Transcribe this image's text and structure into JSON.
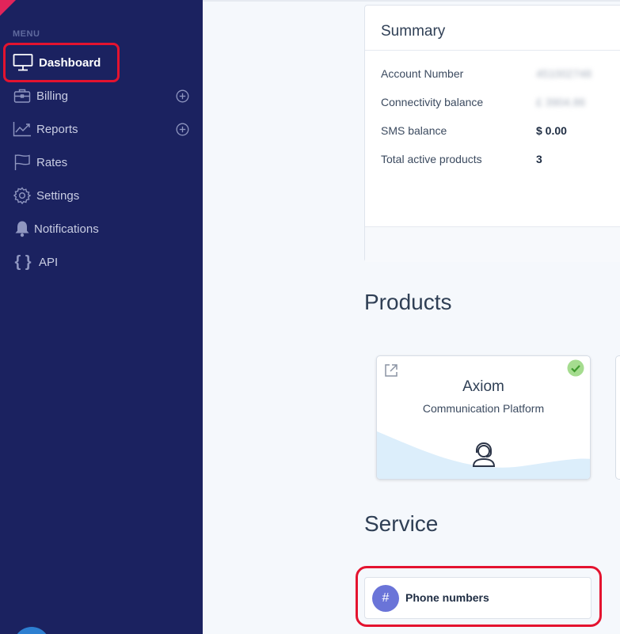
{
  "sidebar": {
    "menu_caption": "MENU",
    "items": [
      {
        "label": "Dashboard",
        "icon": "monitor-icon",
        "active": true,
        "expandable": false
      },
      {
        "label": "Billing",
        "icon": "briefcase-icon",
        "active": false,
        "expandable": true
      },
      {
        "label": "Reports",
        "icon": "trending-chart-icon",
        "active": false,
        "expandable": true
      },
      {
        "label": "Rates",
        "icon": "flag-icon",
        "active": false,
        "expandable": false
      },
      {
        "label": "Settings",
        "icon": "gear-icon",
        "active": false,
        "expandable": false
      },
      {
        "label": "Notifications",
        "icon": "bell-icon",
        "active": false,
        "expandable": false
      },
      {
        "label": "API",
        "icon": "curly-braces-icon",
        "active": false,
        "expandable": false
      }
    ]
  },
  "summary": {
    "title": "Summary",
    "rows": [
      {
        "label": "Account Number",
        "value": "451002748",
        "redacted": true
      },
      {
        "label": "Connectivity balance",
        "value": "£ 3904.86",
        "redacted": true
      },
      {
        "label": "SMS balance",
        "value": "$ 0.00",
        "redacted": false
      },
      {
        "label": "Total active products",
        "value": "3",
        "redacted": false
      }
    ]
  },
  "products": {
    "heading": "Products",
    "cards": [
      {
        "name": "Axiom",
        "subtitle": "Communication Platform",
        "active": true
      }
    ]
  },
  "service": {
    "heading": "Service",
    "items": [
      {
        "label": "Phone numbers",
        "badge": "#"
      }
    ]
  },
  "colors": {
    "sidebar_bg": "#1b2260",
    "highlight": "#e4132f",
    "badge": "#6a74d8",
    "check": "#7cc86b"
  }
}
